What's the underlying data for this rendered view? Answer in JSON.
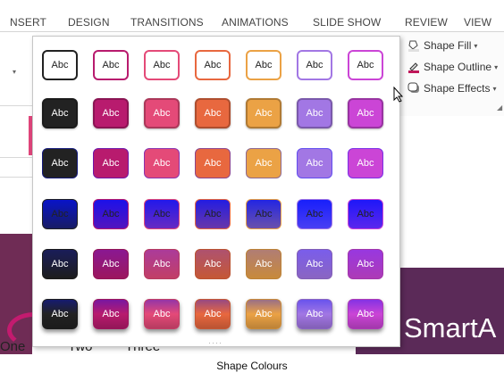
{
  "ribbon_tabs": [
    "NSERT",
    "DESIGN",
    "TRANSITIONS",
    "ANIMATIONS",
    "SLIDE SHOW",
    "REVIEW",
    "VIEW"
  ],
  "ribbon_commands": {
    "shape_fill": "Shape Fill",
    "shape_outline": "Shape Outline",
    "shape_effects": "Shape Effects"
  },
  "gallery": {
    "cell_label": "Abc",
    "theme_colors": [
      "#222222",
      "#b81b6e",
      "#e44a78",
      "#e8683f",
      "#eba245",
      "#a277e4",
      "#cb45d6"
    ],
    "rows": [
      "outline",
      "solid",
      "flat",
      "light-gradient",
      "dark-gradient",
      "glossy"
    ]
  },
  "slide": {
    "title_fragment": "SmartA",
    "smartart_text_1": "One",
    "smartart_text_2": "Two",
    "smartart_text_3": "Three"
  },
  "caption": "Shape Colours"
}
